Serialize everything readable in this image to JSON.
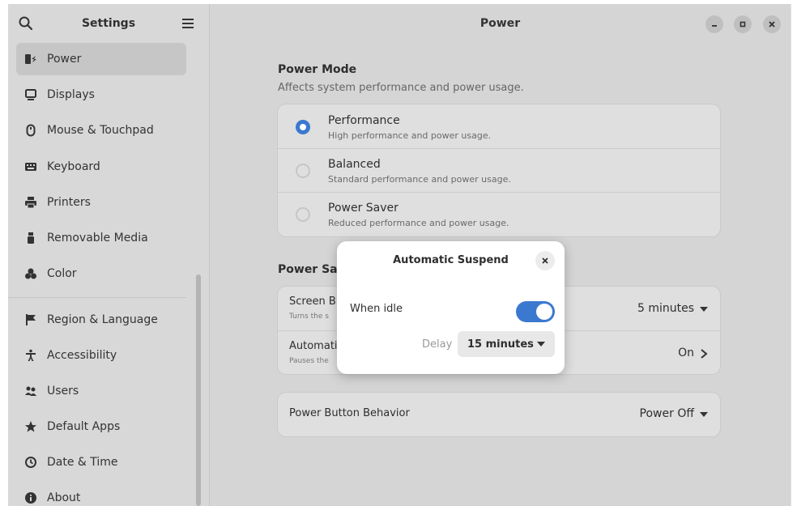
{
  "sidebar": {
    "title": "Settings",
    "items": [
      {
        "label": "Power",
        "icon": "power-icon"
      },
      {
        "label": "Displays",
        "icon": "display-icon"
      },
      {
        "label": "Mouse & Touchpad",
        "icon": "mouse-icon"
      },
      {
        "label": "Keyboard",
        "icon": "keyboard-icon"
      },
      {
        "label": "Printers",
        "icon": "printer-icon"
      },
      {
        "label": "Removable Media",
        "icon": "usb-icon"
      },
      {
        "label": "Color",
        "icon": "color-icon"
      },
      {
        "label": "Region & Language",
        "icon": "flag-icon"
      },
      {
        "label": "Accessibility",
        "icon": "accessibility-icon"
      },
      {
        "label": "Users",
        "icon": "users-icon"
      },
      {
        "label": "Default Apps",
        "icon": "star-icon"
      },
      {
        "label": "Date & Time",
        "icon": "clock-icon"
      },
      {
        "label": "About",
        "icon": "info-icon"
      }
    ]
  },
  "main": {
    "title": "Power",
    "power_mode": {
      "title": "Power Mode",
      "subtitle": "Affects system performance and power usage.",
      "options": [
        {
          "title": "Performance",
          "subtitle": "High performance and power usage.",
          "selected": true
        },
        {
          "title": "Balanced",
          "subtitle": "Standard performance and power usage.",
          "selected": false
        },
        {
          "title": "Power Saver",
          "subtitle": "Reduced performance and power usage.",
          "selected": false
        }
      ]
    },
    "power_saving": {
      "title": "Power Savi",
      "rows": [
        {
          "label": "Screen Bl",
          "sub": "Turns the s",
          "value": "5 minutes"
        },
        {
          "label": "Automati",
          "sub": "Pauses the",
          "value": "On"
        }
      ]
    },
    "power_button": {
      "label": "Power Button Behavior",
      "value": "Power Off"
    }
  },
  "dialog": {
    "title": "Automatic Suspend",
    "idle_label": "When idle",
    "idle_enabled": true,
    "delay_label": "Delay",
    "delay_value": "15 minutes"
  },
  "colors": {
    "accent": "#3b78d0",
    "sidebar_bg": "#d8d8d8",
    "content_bg": "#d5d5d5",
    "dialog_bg": "#ffffff"
  }
}
